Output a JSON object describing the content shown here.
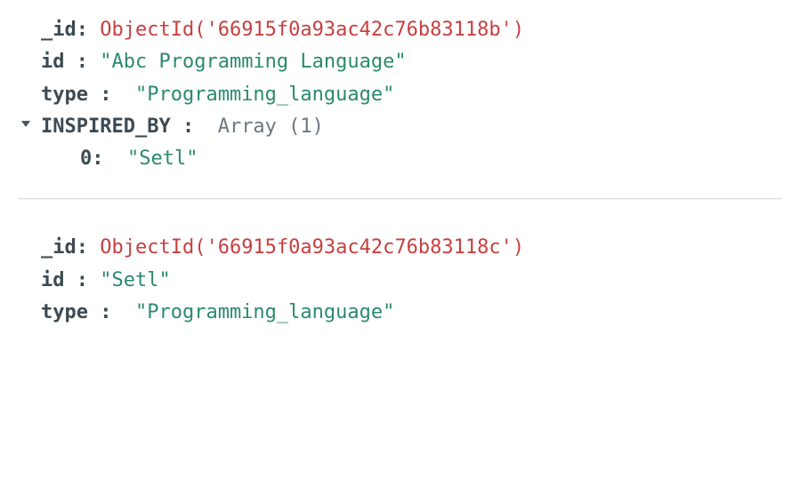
{
  "documents": [
    {
      "fields": [
        {
          "key": "_id",
          "colon": ": ",
          "value": "ObjectId('66915f0a93ac42c76b83118b')",
          "vclass": "val-objectid"
        },
        {
          "key": "id ",
          "colon": ": ",
          "value": "\"Abc Programming Language\"",
          "vclass": "val-string"
        },
        {
          "key": "type ",
          "colon": ": ",
          "value": " \"Programming_language\"",
          "vclass": "val-string"
        },
        {
          "key": "INSPIRED_BY ",
          "colon": ": ",
          "value": " Array (1)",
          "vclass": "val-plain",
          "caret": true,
          "children": [
            {
              "key": "0",
              "colon": ": ",
              "value": " \"Setl\"",
              "vclass": "val-string"
            }
          ]
        }
      ]
    },
    {
      "fields": [
        {
          "key": "_id",
          "colon": ": ",
          "value": "ObjectId('66915f0a93ac42c76b83118c')",
          "vclass": "val-objectid"
        },
        {
          "key": "id ",
          "colon": ": ",
          "value": "\"Setl\"",
          "vclass": "val-string"
        },
        {
          "key": "type ",
          "colon": ": ",
          "value": " \"Programming_language\"",
          "vclass": "val-string"
        }
      ]
    }
  ]
}
